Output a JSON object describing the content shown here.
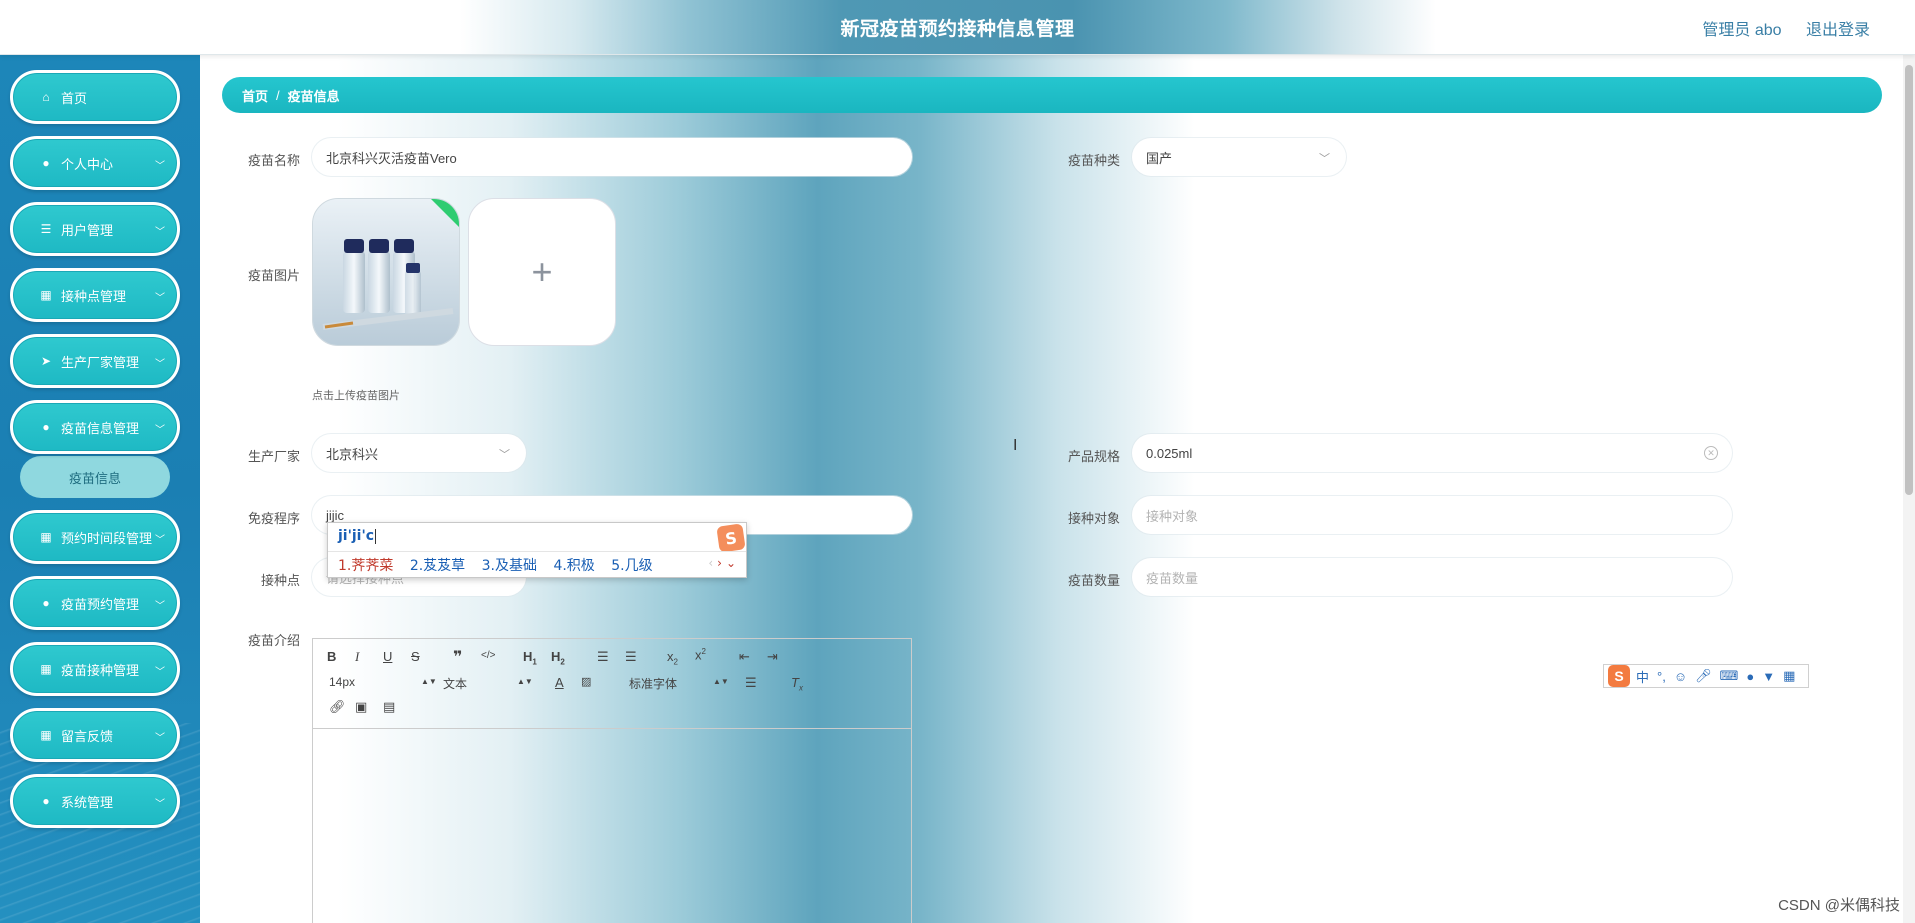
{
  "header": {
    "title": "新冠疫苗预约接种信息管理",
    "user": "管理员 abo",
    "logout": "退出登录"
  },
  "sidebar": {
    "items": [
      {
        "label": "首页",
        "icon": "home-icon",
        "glyph": "⌂"
      },
      {
        "label": "个人中心",
        "icon": "user-icon",
        "glyph": "●"
      },
      {
        "label": "用户管理",
        "icon": "sliders-icon",
        "glyph": "☰"
      },
      {
        "label": "接种点管理",
        "icon": "grid-icon",
        "glyph": "▦"
      },
      {
        "label": "生产厂家管理",
        "icon": "paper-plane-icon",
        "glyph": "➤"
      },
      {
        "label": "疫苗信息管理",
        "icon": "location-pin-icon",
        "glyph": "●"
      },
      {
        "label": "预约时间段管理",
        "icon": "grid-icon",
        "glyph": "▦"
      },
      {
        "label": "疫苗预约管理",
        "icon": "user-icon",
        "glyph": "●"
      },
      {
        "label": "疫苗接种管理",
        "icon": "grid-icon",
        "glyph": "▦"
      },
      {
        "label": "留言反馈",
        "icon": "grid-icon",
        "glyph": "▦"
      },
      {
        "label": "系统管理",
        "icon": "person-icon",
        "glyph": "●"
      }
    ],
    "subitem": "疫苗信息"
  },
  "breadcrumb": {
    "home": "首页",
    "separator": "/",
    "current": "疫苗信息"
  },
  "form": {
    "vaccine_name_label": "疫苗名称",
    "vaccine_name_value": "北京科兴灭活疫苗Vero",
    "vaccine_type_label": "疫苗种类",
    "vaccine_type_value": "国产",
    "vaccine_image_label": "疫苗图片",
    "upload_tip": "点击上传疫苗图片",
    "upload_plus": "+",
    "manufacturer_label": "生产厂家",
    "manufacturer_value": "北京科兴",
    "spec_label": "产品规格",
    "spec_value": "0.025ml",
    "procedure_label": "免疫程序",
    "procedure_value": "jijic",
    "target_label": "接种对象",
    "target_placeholder": "接种对象",
    "site_label": "接种点",
    "site_placeholder": "请选择接种点",
    "quantity_label": "疫苗数量",
    "quantity_placeholder": "疫苗数量",
    "intro_label": "疫苗介绍"
  },
  "ime": {
    "composition": "ji'ji'c",
    "candidates": [
      "1.荠荠菜",
      "2.芨芨草",
      "3.及基础",
      "4.积极",
      "5.几级"
    ],
    "logo": "S"
  },
  "editor": {
    "font_size": "14px",
    "header_select": "文本",
    "font_select": "标准字体"
  },
  "ime_bar": {
    "logo": "S",
    "mode": "中",
    "punct": "°,"
  },
  "watermark": "CSDN @米偶科技",
  "colors": {
    "accent": "#1fbcc6",
    "sidebar": "#1d86b9",
    "link": "#3a7fa6"
  }
}
